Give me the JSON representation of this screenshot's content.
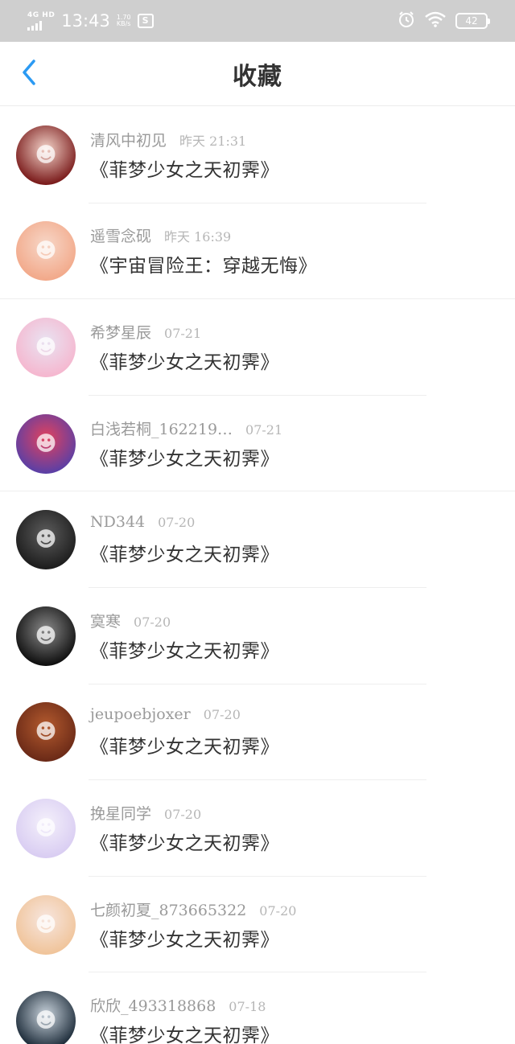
{
  "status_bar": {
    "network": "4G HD",
    "time": "13:43",
    "speed_value": "1.70",
    "speed_unit": "KB/s",
    "sim_label": "S",
    "battery": "42"
  },
  "header": {
    "title": "收藏"
  },
  "items": [
    {
      "name": "清风中初见",
      "date": "昨天 21:31",
      "book": "《菲梦少女之天初霁》",
      "avatar_colors": [
        "#7a1b1b",
        "#f3d3c9"
      ],
      "icon": "avatar-portrait"
    },
    {
      "name": "遥雪念砚",
      "date": "昨天 16:39",
      "book": "《宇宙冒险王：穿越无悔》",
      "avatar_colors": [
        "#f2a98a",
        "#f7d7c8"
      ],
      "icon": "avatar-portrait"
    },
    {
      "name": "希梦星辰",
      "date": "07-21",
      "book": "《菲梦少女之天初霁》",
      "avatar_colors": [
        "#f5b7cf",
        "#e9e3f2"
      ],
      "icon": "avatar-portrait"
    },
    {
      "name": "白浅若桐_162219…",
      "date": "07-21",
      "book": "《菲梦少女之天初霁》",
      "avatar_colors": [
        "#5b3fa5",
        "#e3425d"
      ],
      "icon": "avatar-portrait"
    },
    {
      "name": "ND344",
      "date": "07-20",
      "book": "《菲梦少女之天初霁》",
      "avatar_colors": [
        "#1d1d1d",
        "#5c5c5c"
      ],
      "icon": "avatar-portrait"
    },
    {
      "name": "寞寒",
      "date": "07-20",
      "book": "《菲梦少女之天初霁》",
      "avatar_colors": [
        "#0f0f0f",
        "#8a8a8a"
      ],
      "icon": "avatar-portrait"
    },
    {
      "name": "jeupoebjoxer",
      "date": "07-20",
      "book": "《菲梦少女之天初霁》",
      "avatar_colors": [
        "#6b2a17",
        "#b35a2e"
      ],
      "icon": "avatar-portrait"
    },
    {
      "name": "挽星同学",
      "date": "07-20",
      "book": "《菲梦少女之天初霁》",
      "avatar_colors": [
        "#d9cdf2",
        "#f4f0fb"
      ],
      "icon": "avatar-portrait"
    },
    {
      "name": "七颜初夏_873665322",
      "date": "07-20",
      "book": "《菲梦少女之天初霁》",
      "avatar_colors": [
        "#f0c49a",
        "#f7e6df"
      ],
      "icon": "avatar-portrait"
    },
    {
      "name": "欣欣_493318868",
      "date": "07-18",
      "book": "《菲梦少女之天初霁》",
      "avatar_colors": [
        "#1b2a38",
        "#c9d3dc"
      ],
      "icon": "avatar-portrait"
    }
  ],
  "colors": {
    "accent": "#2b9af3",
    "name_text": "#9a9a9a",
    "book_text": "#333333"
  }
}
